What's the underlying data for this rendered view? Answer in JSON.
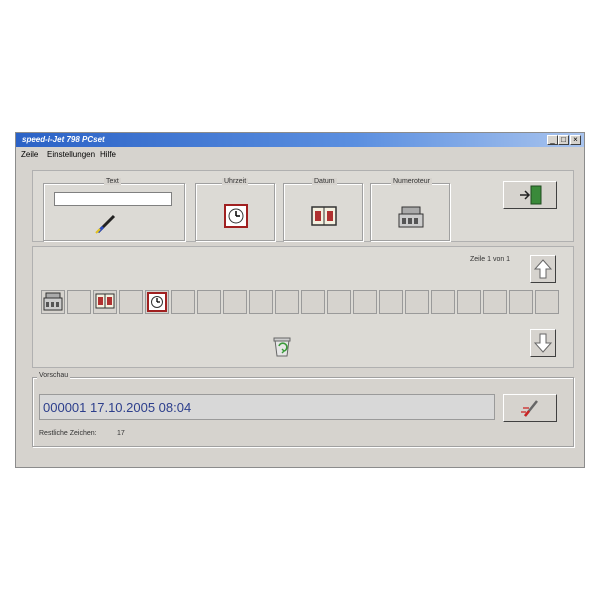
{
  "window": {
    "title": "speed-i-Jet 798 PCset",
    "controls": {
      "minimize": "_",
      "maximize": "□",
      "close": "×"
    }
  },
  "menu": [
    {
      "label": "Zeile"
    },
    {
      "label": "Einstellungen"
    },
    {
      "label": "Hilfe"
    }
  ],
  "tools": {
    "text": {
      "label": "Text",
      "value": ""
    },
    "time": {
      "label": "Uhrzeit"
    },
    "date": {
      "label": "Datum"
    },
    "counter": {
      "label": "Numeroteur"
    }
  },
  "editor": {
    "line_indicator": "Zeile 1 von 1"
  },
  "preview": {
    "label": "Vorschau",
    "text": "000001 17.10.2005 08:04",
    "remaining_label": "Restliche Zeichen:",
    "remaining_value": "17"
  },
  "icons": {
    "exit": "exit-door-icon",
    "text": "pen-icon",
    "time": "clock-icon",
    "date": "calendar-icon",
    "counter": "counter-icon",
    "up": "arrow-up-icon",
    "down": "arrow-down-icon",
    "trash": "recycle-bin-icon",
    "print": "print-pen-icon"
  },
  "colors": {
    "titlebar_start": "#2b62c6",
    "window_bg": "#d6d3ce",
    "preview_text": "#2c3e8c",
    "clock_frame": "#a02020"
  }
}
